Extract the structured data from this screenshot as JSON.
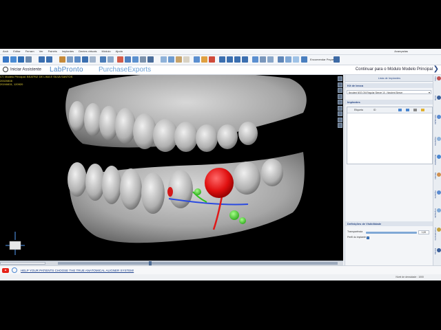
{
  "menu": {
    "items": [
      "Arch",
      "Editar",
      "Ferram",
      "Ver",
      "Painéis",
      "Implantes",
      "Dentes virtuais",
      "Módulo",
      "Ajuda"
    ],
    "right_label": "Avançadas"
  },
  "toolbar": {
    "search_label": "Encomendar Peças"
  },
  "header": {
    "assistant_label": "Iniciar Assistente",
    "logo_left": "LabPronto",
    "logo_right": "PurchaseExports",
    "continue_label": "Continuar para o Módulo Modelo Principal"
  },
  "viewport": {
    "patient_lines": [
      "CT, Modelo Principal: BEATRIZ DE LIMA E SILVA SANTOS",
      "20020808",
      "20240831, 120920"
    ]
  },
  "panel": {
    "title": "Lista de Implantes",
    "kit_section": "Kit de broca",
    "kit_value": "Neodent NSS GM Regular Sleeve 10 - Neodent Sleeve",
    "implants_section": "Implantes",
    "columns": [
      "Etiqueta",
      "ID"
    ],
    "visibility_section": "Definições de Visibilidade",
    "transparency_label": "Transparência",
    "transparency_value": "1,00",
    "transparency_level": 0.92,
    "profile_label": "Perfil do implante"
  },
  "side_tabs": [
    "Vista",
    "Corte",
    "Simulação",
    "Implantes",
    "Resultados",
    "Modelo",
    "Implante",
    "Ampliação",
    "Procedimento",
    "Escala"
  ],
  "status": {
    "link_text": "HELP YOUR PATIENTS CHOOSE THE TRUE ANATOMICAL ALIGNER SYSTEM!",
    "zoom_text": "Nível de densidade : 1000"
  }
}
